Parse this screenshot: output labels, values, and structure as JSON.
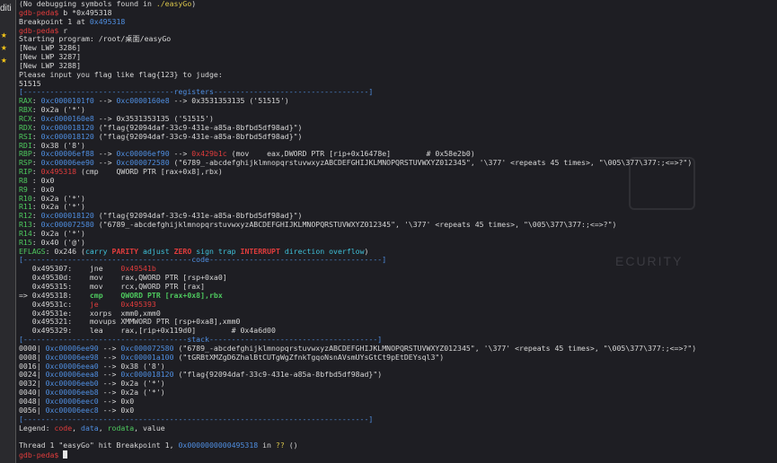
{
  "sidebar": {
    "cut_text": "diti"
  },
  "watermark": "ECURITY",
  "lines": [
    {
      "name": "log-line",
      "seg": [
        {
          "t": "(No debugging symbols found in ",
          "c": ""
        },
        {
          "t": "./easyGo",
          "c": "yel"
        },
        {
          "t": ")",
          "c": ""
        }
      ]
    },
    {
      "name": "prompt-line",
      "seg": [
        {
          "t": "gdb-peda$",
          "c": "red"
        },
        {
          "t": " b *0x495318",
          "c": ""
        }
      ]
    },
    {
      "name": "log-line",
      "seg": [
        {
          "t": "Breakpoint 1 at ",
          "c": ""
        },
        {
          "t": "0x495318",
          "c": "blue"
        }
      ]
    },
    {
      "name": "prompt-line",
      "seg": [
        {
          "t": "gdb-peda$",
          "c": "red"
        },
        {
          "t": " r",
          "c": ""
        }
      ]
    },
    {
      "name": "log-line",
      "seg": [
        {
          "t": "Starting program: /root/桌面/easyGo",
          "c": ""
        }
      ]
    },
    {
      "name": "log-line",
      "seg": [
        {
          "t": "[New LWP 3286]",
          "c": ""
        }
      ]
    },
    {
      "name": "log-line",
      "seg": [
        {
          "t": "[New LWP 3287]",
          "c": ""
        }
      ]
    },
    {
      "name": "log-line",
      "seg": [
        {
          "t": "[New LWP 3288]",
          "c": ""
        }
      ]
    },
    {
      "name": "log-line",
      "seg": [
        {
          "t": "Please input you flag like flag{123} to judge:",
          "c": ""
        }
      ]
    },
    {
      "name": "log-line",
      "seg": [
        {
          "t": "51515",
          "c": ""
        }
      ]
    },
    {
      "name": "section-header",
      "seg": [
        {
          "t": "[----------------------------------",
          "c": "blue"
        },
        {
          "t": "registers",
          "c": "blue"
        },
        {
          "t": "-----------------------------------]",
          "c": "blue"
        }
      ]
    },
    {
      "name": "register-line",
      "seg": [
        {
          "t": "RAX",
          "c": "green"
        },
        {
          "t": ": ",
          "c": ""
        },
        {
          "t": "0xc0000101f0",
          "c": "blue"
        },
        {
          "t": " --> ",
          "c": ""
        },
        {
          "t": "0xc0000160e8",
          "c": "blue"
        },
        {
          "t": " --> 0x3531353135 ('51515')",
          "c": ""
        }
      ]
    },
    {
      "name": "register-line",
      "seg": [
        {
          "t": "RBX",
          "c": "green"
        },
        {
          "t": ": 0x2a ('*')",
          "c": ""
        }
      ]
    },
    {
      "name": "register-line",
      "seg": [
        {
          "t": "RCX",
          "c": "green"
        },
        {
          "t": ": ",
          "c": ""
        },
        {
          "t": "0xc0000160e8",
          "c": "blue"
        },
        {
          "t": " --> 0x3531353135 ('51515')",
          "c": ""
        }
      ]
    },
    {
      "name": "register-line",
      "seg": [
        {
          "t": "RDX",
          "c": "green"
        },
        {
          "t": ": ",
          "c": ""
        },
        {
          "t": "0xc000018120",
          "c": "blue"
        },
        {
          "t": " (\"flag{92094daf-33c9-431e-a85a-8bfbd5df98ad}\")",
          "c": ""
        }
      ]
    },
    {
      "name": "register-line",
      "seg": [
        {
          "t": "RSI",
          "c": "green"
        },
        {
          "t": ": ",
          "c": ""
        },
        {
          "t": "0xc000018120",
          "c": "blue"
        },
        {
          "t": " (\"flag{92094daf-33c9-431e-a85a-8bfbd5df98ad}\")",
          "c": ""
        }
      ]
    },
    {
      "name": "register-line",
      "seg": [
        {
          "t": "RDI",
          "c": "green"
        },
        {
          "t": ": 0x38 ('8')",
          "c": ""
        }
      ]
    },
    {
      "name": "register-line",
      "seg": [
        {
          "t": "RBP",
          "c": "green"
        },
        {
          "t": ": ",
          "c": ""
        },
        {
          "t": "0xc00006ef88",
          "c": "blue"
        },
        {
          "t": " --> ",
          "c": ""
        },
        {
          "t": "0xc00006ef90",
          "c": "blue"
        },
        {
          "t": " --> ",
          "c": ""
        },
        {
          "t": "0x429b1c",
          "c": "red"
        },
        {
          "t": " (mov    eax,DWORD PTR [rip+0x16478e]        # 0x58e2b0)",
          "c": ""
        }
      ]
    },
    {
      "name": "register-line",
      "seg": [
        {
          "t": "RSP",
          "c": "green"
        },
        {
          "t": ": ",
          "c": ""
        },
        {
          "t": "0xc00006ee90",
          "c": "blue"
        },
        {
          "t": " --> ",
          "c": ""
        },
        {
          "t": "0xc000072580",
          "c": "blue"
        },
        {
          "t": " (\"6789_-abcdefghijklmnopqrstuvwxyzABCDEFGHIJKLMNOPQRSTUVWXYZ012345\", '\\377' <repeats 45 times>, \"\\005\\377\\377:;<=>?\")",
          "c": ""
        }
      ]
    },
    {
      "name": "register-line",
      "seg": [
        {
          "t": "RIP",
          "c": "green"
        },
        {
          "t": ": ",
          "c": ""
        },
        {
          "t": "0x495318",
          "c": "red"
        },
        {
          "t": " (cmp    QWORD PTR [rax+0x8],rbx)",
          "c": ""
        }
      ]
    },
    {
      "name": "register-line",
      "seg": [
        {
          "t": "R8",
          "c": "green"
        },
        {
          "t": " : 0x0",
          "c": ""
        }
      ]
    },
    {
      "name": "register-line",
      "seg": [
        {
          "t": "R9",
          "c": "green"
        },
        {
          "t": " : 0x0",
          "c": ""
        }
      ]
    },
    {
      "name": "register-line",
      "seg": [
        {
          "t": "R10",
          "c": "green"
        },
        {
          "t": ": 0x2a ('*')",
          "c": ""
        }
      ]
    },
    {
      "name": "register-line",
      "seg": [
        {
          "t": "R11",
          "c": "green"
        },
        {
          "t": ": 0x2a ('*')",
          "c": ""
        }
      ]
    },
    {
      "name": "register-line",
      "seg": [
        {
          "t": "R12",
          "c": "green"
        },
        {
          "t": ": ",
          "c": ""
        },
        {
          "t": "0xc000018120",
          "c": "blue"
        },
        {
          "t": " (\"flag{92094daf-33c9-431e-a85a-8bfbd5df98ad}\")",
          "c": ""
        }
      ]
    },
    {
      "name": "register-line",
      "seg": [
        {
          "t": "R13",
          "c": "green"
        },
        {
          "t": ": ",
          "c": ""
        },
        {
          "t": "0xc000072580",
          "c": "blue"
        },
        {
          "t": " (\"6789_-abcdefghijklmnopqrstuvwxyzABCDEFGHIJKLMNOPQRSTUVWXYZ012345\", '\\377' <repeats 45 times>, \"\\005\\377\\377:;<=>?\")",
          "c": ""
        }
      ]
    },
    {
      "name": "register-line",
      "seg": [
        {
          "t": "R14",
          "c": "green"
        },
        {
          "t": ": 0x2a ('*')",
          "c": ""
        }
      ]
    },
    {
      "name": "register-line",
      "seg": [
        {
          "t": "R15",
          "c": "green"
        },
        {
          "t": ": 0x40 ('@')",
          "c": ""
        }
      ]
    },
    {
      "name": "eflags-line",
      "seg": [
        {
          "t": "EFLAGS",
          "c": "green"
        },
        {
          "t": ": 0x246 (",
          "c": ""
        },
        {
          "t": "carry ",
          "c": "cyan"
        },
        {
          "t": "PARITY ",
          "c": "red bold"
        },
        {
          "t": "adjust ",
          "c": "cyan"
        },
        {
          "t": "ZERO ",
          "c": "red bold"
        },
        {
          "t": "sign trap ",
          "c": "cyan"
        },
        {
          "t": "INTERRUPT ",
          "c": "red bold"
        },
        {
          "t": "direction overflow",
          "c": "cyan"
        },
        {
          "t": ")",
          "c": ""
        }
      ]
    },
    {
      "name": "section-header",
      "seg": [
        {
          "t": "[--------------------------------------",
          "c": "blue"
        },
        {
          "t": "code",
          "c": "blue"
        },
        {
          "t": "---------------------------------------]",
          "c": "blue"
        }
      ]
    },
    {
      "name": "code-line",
      "seg": [
        {
          "t": "   0x495307:\tjne    ",
          "c": ""
        },
        {
          "t": "0x49541b",
          "c": "red"
        }
      ]
    },
    {
      "name": "code-line",
      "seg": [
        {
          "t": "   0x49530d:\tmov    rax,QWORD PTR [rsp+0xa0]",
          "c": ""
        }
      ]
    },
    {
      "name": "code-line",
      "seg": [
        {
          "t": "   0x495315:\tmov    rcx,QWORD PTR [rax]",
          "c": ""
        }
      ]
    },
    {
      "name": "code-line-current",
      "seg": [
        {
          "t": "=> 0x495318:\t",
          "c": ""
        },
        {
          "t": "cmp    QWORD PTR [rax+0x8],rbx",
          "c": "green bold"
        }
      ]
    },
    {
      "name": "code-line",
      "seg": [
        {
          "t": "   0x49531c:\t",
          "c": ""
        },
        {
          "t": "je     ",
          "c": "red"
        },
        {
          "t": "0x495393",
          "c": "red"
        }
      ]
    },
    {
      "name": "code-line",
      "seg": [
        {
          "t": "   0x49531e:\txorps  xmm0,xmm0",
          "c": ""
        }
      ]
    },
    {
      "name": "code-line",
      "seg": [
        {
          "t": "   0x495321:\tmovups XMMWORD PTR [rsp+0xa8],xmm0",
          "c": ""
        }
      ]
    },
    {
      "name": "code-line",
      "seg": [
        {
          "t": "   0x495329:\tlea    rax,[rip+0x119d0]        # 0x4a6d00",
          "c": ""
        }
      ]
    },
    {
      "name": "section-header",
      "seg": [
        {
          "t": "[-------------------------------------",
          "c": "blue"
        },
        {
          "t": "stack",
          "c": "blue"
        },
        {
          "t": "--------------------------------------]",
          "c": "blue"
        }
      ]
    },
    {
      "name": "stack-line",
      "seg": [
        {
          "t": "0000| ",
          "c": ""
        },
        {
          "t": "0xc00006ee90",
          "c": "blue"
        },
        {
          "t": " --> ",
          "c": ""
        },
        {
          "t": "0xc000072580",
          "c": "blue"
        },
        {
          "t": " (\"6789_-abcdefghijklmnopqrstuvwxyzABCDEFGHIJKLMNOPQRSTUVWXYZ012345\", '\\377' <repeats 45 times>, \"\\005\\377\\377:;<=>?\")",
          "c": ""
        }
      ]
    },
    {
      "name": "stack-line",
      "seg": [
        {
          "t": "0008| ",
          "c": ""
        },
        {
          "t": "0xc00006ee98",
          "c": "blue"
        },
        {
          "t": " --> ",
          "c": ""
        },
        {
          "t": "0xc00001a100",
          "c": "blue"
        },
        {
          "t": " (\"tGRBtXMZgD6ZhalBtCUTgWgZfnkTgqoNsnAVsmUYsGtCt9pEtDEYsql3\")",
          "c": ""
        }
      ]
    },
    {
      "name": "stack-line",
      "seg": [
        {
          "t": "0016| ",
          "c": ""
        },
        {
          "t": "0xc00006eea0",
          "c": "blue"
        },
        {
          "t": " --> 0x38 ('8')",
          "c": ""
        }
      ]
    },
    {
      "name": "stack-line",
      "seg": [
        {
          "t": "0024| ",
          "c": ""
        },
        {
          "t": "0xc00006eea8",
          "c": "blue"
        },
        {
          "t": " --> ",
          "c": ""
        },
        {
          "t": "0xc000018120",
          "c": "blue"
        },
        {
          "t": " (\"flag{92094daf-33c9-431e-a85a-8bfbd5df98ad}\")",
          "c": ""
        }
      ]
    },
    {
      "name": "stack-line",
      "seg": [
        {
          "t": "0032| ",
          "c": ""
        },
        {
          "t": "0xc00006eeb0",
          "c": "blue"
        },
        {
          "t": " --> 0x2a ('*')",
          "c": ""
        }
      ]
    },
    {
      "name": "stack-line",
      "seg": [
        {
          "t": "0040| ",
          "c": ""
        },
        {
          "t": "0xc00006eeb8",
          "c": "blue"
        },
        {
          "t": " --> 0x2a ('*')",
          "c": ""
        }
      ]
    },
    {
      "name": "stack-line",
      "seg": [
        {
          "t": "0048| ",
          "c": ""
        },
        {
          "t": "0xc00006eec0",
          "c": "blue"
        },
        {
          "t": " --> 0x0",
          "c": ""
        }
      ]
    },
    {
      "name": "stack-line",
      "seg": [
        {
          "t": "0056| ",
          "c": ""
        },
        {
          "t": "0xc00006eec8",
          "c": "blue"
        },
        {
          "t": " --> 0x0",
          "c": ""
        }
      ]
    },
    {
      "name": "section-footer",
      "seg": [
        {
          "t": "[------------------------------------------------------------------------------]",
          "c": "blue"
        }
      ]
    },
    {
      "name": "legend-line",
      "seg": [
        {
          "t": "Legend: ",
          "c": ""
        },
        {
          "t": "code",
          "c": "red"
        },
        {
          "t": ", ",
          "c": ""
        },
        {
          "t": "data",
          "c": "blue"
        },
        {
          "t": ", ",
          "c": ""
        },
        {
          "t": "rodata",
          "c": "green"
        },
        {
          "t": ", value",
          "c": ""
        }
      ]
    },
    {
      "name": "blank-line",
      "seg": [
        {
          "t": "",
          "c": ""
        }
      ]
    },
    {
      "name": "log-line",
      "seg": [
        {
          "t": "Thread 1 \"easyGo\" hit Breakpoint 1, ",
          "c": ""
        },
        {
          "t": "0x0000000000495318",
          "c": "blue"
        },
        {
          "t": " in ",
          "c": ""
        },
        {
          "t": "??",
          "c": "yel"
        },
        {
          "t": " ()",
          "c": ""
        }
      ]
    },
    {
      "name": "prompt-line",
      "seg": [
        {
          "t": "gdb-peda$",
          "c": "red"
        },
        {
          "t": " ",
          "c": ""
        }
      ]
    }
  ]
}
